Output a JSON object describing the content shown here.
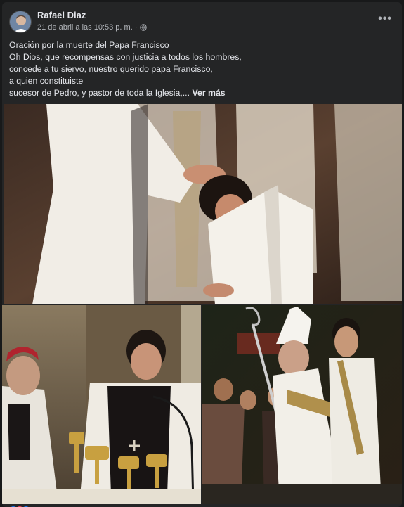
{
  "post": {
    "author": "Rafael Diaz",
    "timestamp": "21 de abril a las 10:53 p. m. ·",
    "privacy_icon": "globe-icon",
    "more_icon": "more-options-icon",
    "more_label": "•••",
    "text_lines": [
      "Oración por la muerte del Papa Francisco",
      "Oh Dios, que recompensas con justicia a todos los hombres,",
      "concede a tu siervo, nuestro querido papa Francisco,",
      "a quien constituiste",
      "sucesor de Pedro, y pastor de toda la Iglesia,..."
    ],
    "see_more": "Ver más"
  },
  "photos": [
    {
      "name": "ordination-photo",
      "style": "warm"
    },
    {
      "name": "altar-photo",
      "style": "warm"
    },
    {
      "name": "procession-photo",
      "style": "warm"
    }
  ],
  "colors": {
    "background": "#18191a",
    "card": "#242526",
    "primary_text": "#e4e6eb",
    "secondary_text": "#b0b3b8"
  }
}
